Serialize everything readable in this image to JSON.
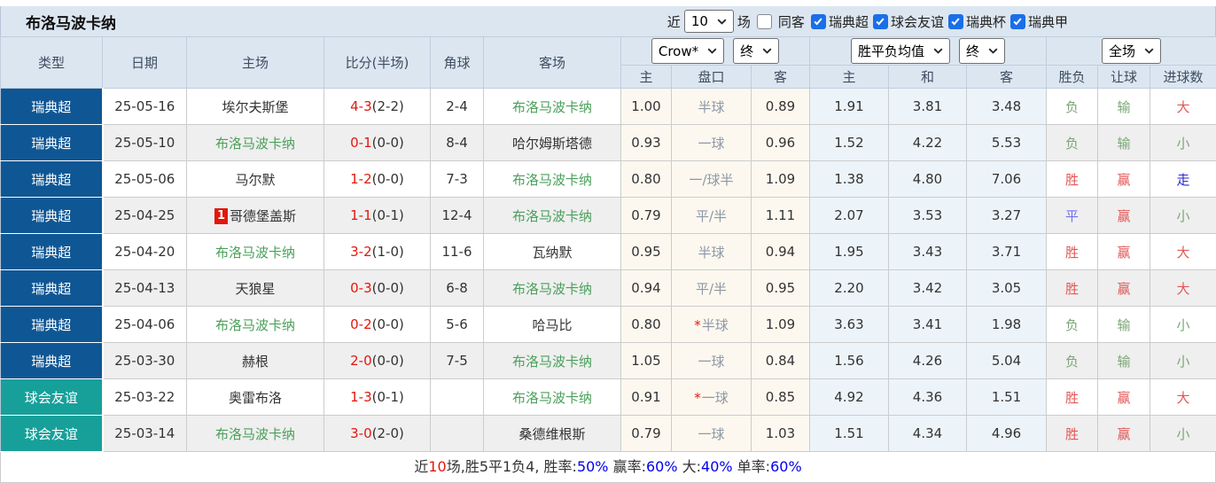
{
  "header": {
    "team_name": "布洛马波卡纳",
    "recent_label": "近",
    "recent_value": "10",
    "matches_label": "场",
    "same_venue": {
      "label": "同客",
      "checked": false
    },
    "league_filters": [
      {
        "label": "瑞典超",
        "checked": true
      },
      {
        "label": "球会友谊",
        "checked": true
      },
      {
        "label": "瑞典杯",
        "checked": true
      },
      {
        "label": "瑞典甲",
        "checked": true
      }
    ]
  },
  "table": {
    "main_headers": [
      "类型",
      "日期",
      "主场",
      "比分(半场)",
      "角球",
      "客场"
    ],
    "selects": {
      "bookmaker": "Crow*",
      "bookmaker_time": "终",
      "average": "胜平负均值",
      "average_time": "终",
      "scope": "全场"
    },
    "sub_headers": [
      "主",
      "盘口",
      "客",
      "主",
      "和",
      "客",
      "胜负",
      "让球",
      "进球数"
    ],
    "rows": [
      {
        "league": "瑞典超",
        "league_class": "super",
        "date": "25-05-16",
        "home": "埃尔夫斯堡",
        "home_hl": false,
        "home_rank": "",
        "score": "4-3",
        "half": "(2-2)",
        "corner": "2-4",
        "away": "布洛马波卡纳",
        "away_hl": true,
        "ah_home": "1.00",
        "ah_star": false,
        "handicap": "半球",
        "ah_away": "0.89",
        "o_home": "1.91",
        "o_draw": "3.81",
        "o_away": "3.48",
        "wdl": "负",
        "wdl_c": "green",
        "ah_r": "输",
        "ah_c": "green",
        "ou": "大",
        "ou_c": "red"
      },
      {
        "league": "瑞典超",
        "league_class": "super",
        "date": "25-05-10",
        "home": "布洛马波卡纳",
        "home_hl": true,
        "home_rank": "",
        "score": "0-1",
        "half": "(0-0)",
        "corner": "8-4",
        "away": "哈尔姆斯塔德",
        "away_hl": false,
        "ah_home": "0.93",
        "ah_star": false,
        "handicap": "一球",
        "ah_away": "0.96",
        "o_home": "1.52",
        "o_draw": "4.22",
        "o_away": "5.53",
        "wdl": "负",
        "wdl_c": "green",
        "ah_r": "输",
        "ah_c": "green",
        "ou": "小",
        "ou_c": "green"
      },
      {
        "league": "瑞典超",
        "league_class": "super",
        "date": "25-05-06",
        "home": "马尔默",
        "home_hl": false,
        "home_rank": "",
        "score": "1-2",
        "half": "(0-0)",
        "corner": "7-3",
        "away": "布洛马波卡纳",
        "away_hl": true,
        "ah_home": "0.80",
        "ah_star": false,
        "handicap": "一/球半",
        "ah_away": "1.09",
        "o_home": "1.38",
        "o_draw": "4.80",
        "o_away": "7.06",
        "wdl": "胜",
        "wdl_c": "red",
        "ah_r": "赢",
        "ah_c": "red",
        "ou": "走",
        "ou_c": "blue"
      },
      {
        "league": "瑞典超",
        "league_class": "super",
        "date": "25-04-25",
        "home": "哥德堡盖斯",
        "home_hl": false,
        "home_rank": "1",
        "score": "1-1",
        "half": "(0-1)",
        "corner": "12-4",
        "away": "布洛马波卡纳",
        "away_hl": true,
        "ah_home": "0.79",
        "ah_star": false,
        "handicap": "平/半",
        "ah_away": "1.11",
        "o_home": "2.07",
        "o_draw": "3.53",
        "o_away": "3.27",
        "wdl": "平",
        "wdl_c": "lblue",
        "ah_r": "赢",
        "ah_c": "red",
        "ou": "小",
        "ou_c": "green"
      },
      {
        "league": "瑞典超",
        "league_class": "super",
        "date": "25-04-20",
        "home": "布洛马波卡纳",
        "home_hl": true,
        "home_rank": "",
        "score": "3-2",
        "half": "(1-0)",
        "corner": "11-6",
        "away": "瓦纳默",
        "away_hl": false,
        "ah_home": "0.95",
        "ah_star": false,
        "handicap": "半球",
        "ah_away": "0.94",
        "o_home": "1.95",
        "o_draw": "3.43",
        "o_away": "3.71",
        "wdl": "胜",
        "wdl_c": "red",
        "ah_r": "赢",
        "ah_c": "red",
        "ou": "大",
        "ou_c": "red"
      },
      {
        "league": "瑞典超",
        "league_class": "super",
        "date": "25-04-13",
        "home": "天狼星",
        "home_hl": false,
        "home_rank": "",
        "score": "0-3",
        "half": "(0-0)",
        "corner": "6-8",
        "away": "布洛马波卡纳",
        "away_hl": true,
        "ah_home": "0.94",
        "ah_star": false,
        "handicap": "平/半",
        "ah_away": "0.95",
        "o_home": "2.20",
        "o_draw": "3.42",
        "o_away": "3.05",
        "wdl": "胜",
        "wdl_c": "red",
        "ah_r": "赢",
        "ah_c": "red",
        "ou": "大",
        "ou_c": "red"
      },
      {
        "league": "瑞典超",
        "league_class": "super",
        "date": "25-04-06",
        "home": "布洛马波卡纳",
        "home_hl": true,
        "home_rank": "",
        "score": "0-2",
        "half": "(0-0)",
        "corner": "5-6",
        "away": "哈马比",
        "away_hl": false,
        "ah_home": "0.80",
        "ah_star": true,
        "handicap": "半球",
        "ah_away": "1.09",
        "o_home": "3.63",
        "o_draw": "3.41",
        "o_away": "1.98",
        "wdl": "负",
        "wdl_c": "green",
        "ah_r": "输",
        "ah_c": "green",
        "ou": "小",
        "ou_c": "green"
      },
      {
        "league": "瑞典超",
        "league_class": "super",
        "date": "25-03-30",
        "home": "赫根",
        "home_hl": false,
        "home_rank": "",
        "score": "2-0",
        "half": "(0-0)",
        "corner": "7-5",
        "away": "布洛马波卡纳",
        "away_hl": true,
        "ah_home": "1.05",
        "ah_star": false,
        "handicap": "一球",
        "ah_away": "0.84",
        "o_home": "1.56",
        "o_draw": "4.26",
        "o_away": "5.04",
        "wdl": "负",
        "wdl_c": "green",
        "ah_r": "输",
        "ah_c": "green",
        "ou": "小",
        "ou_c": "green"
      },
      {
        "league": "球会友谊",
        "league_class": "friendly",
        "date": "25-03-22",
        "home": "奥雷布洛",
        "home_hl": false,
        "home_rank": "",
        "score": "1-3",
        "half": "(0-1)",
        "corner": "",
        "away": "布洛马波卡纳",
        "away_hl": true,
        "ah_home": "0.91",
        "ah_star": true,
        "handicap": "一球",
        "ah_away": "0.85",
        "o_home": "4.92",
        "o_draw": "4.36",
        "o_away": "1.51",
        "wdl": "胜",
        "wdl_c": "red",
        "ah_r": "赢",
        "ah_c": "red",
        "ou": "大",
        "ou_c": "red"
      },
      {
        "league": "球会友谊",
        "league_class": "friendly",
        "date": "25-03-14",
        "home": "布洛马波卡纳",
        "home_hl": true,
        "home_rank": "",
        "score": "3-0",
        "half": "(2-0)",
        "corner": "",
        "away": "桑德维根斯",
        "away_hl": false,
        "ah_home": "0.79",
        "ah_star": false,
        "handicap": "一球",
        "ah_away": "1.03",
        "o_home": "1.51",
        "o_draw": "4.34",
        "o_away": "4.96",
        "wdl": "胜",
        "wdl_c": "red",
        "ah_r": "赢",
        "ah_c": "red",
        "ou": "小",
        "ou_c": "green"
      }
    ]
  },
  "footer": {
    "parts": [
      {
        "t": "近",
        "c": "dark"
      },
      {
        "t": "10",
        "c": "red"
      },
      {
        "t": "场,胜5平1负4, 胜率:",
        "c": "dark"
      },
      {
        "t": "50%",
        "c": "blue"
      },
      {
        "t": " 赢率:",
        "c": "dark"
      },
      {
        "t": "60%",
        "c": "blue"
      },
      {
        "t": " 大:",
        "c": "dark"
      },
      {
        "t": "40%",
        "c": "blue"
      },
      {
        "t": " 单率:",
        "c": "dark"
      },
      {
        "t": "60%",
        "c": "blue"
      }
    ]
  },
  "colors": {
    "league_super": "#0f5794",
    "league_friendly": "#17a09a",
    "highlight_team": "#4aa05a",
    "score_red": "#e3170d",
    "result_win": "#e25757",
    "result_lose": "#7ca677",
    "result_push": "#2a2ad2",
    "result_draw": "#7070ee",
    "header_bg": "#dce6f1",
    "handicap_col_bg": "#fdf8ef",
    "avg_col_bg": "#ecf4fa",
    "pct_blue": "#0000ee"
  }
}
